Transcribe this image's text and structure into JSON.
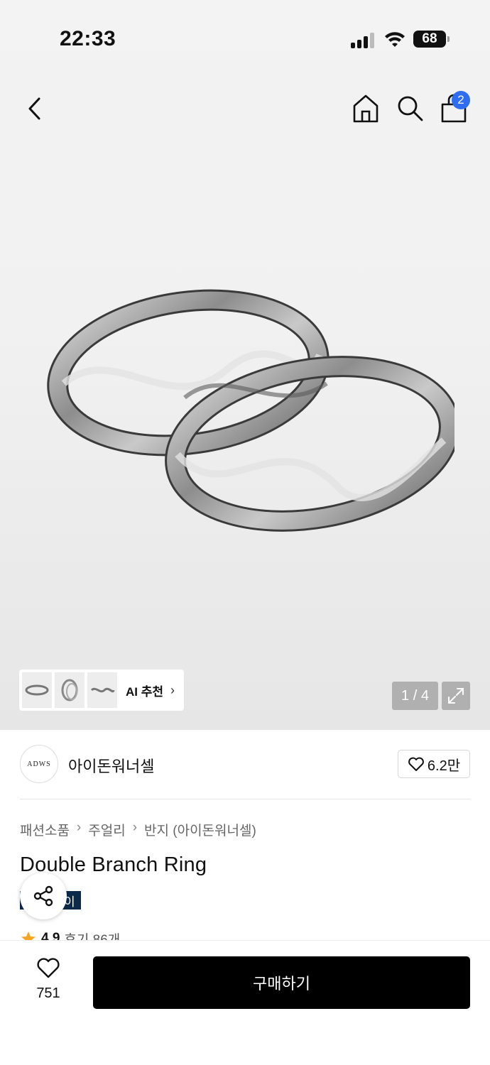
{
  "status": {
    "time": "22:33",
    "battery": "68"
  },
  "nav": {
    "cart_count": "2"
  },
  "gallery": {
    "ai_label": "AI 추천",
    "pager": "1 / 4"
  },
  "seller": {
    "logo_text": "ADWS",
    "name": "아이돈워너셀",
    "likes": "6.2만"
  },
  "breadcrumb": [
    "패션소품",
    "주얼리",
    "반지 (아이돈워너셀)"
  ],
  "product": {
    "title": "Double Branch Ring",
    "tag_tail": "이",
    "rating": "4.9",
    "reviews": "후기 86개"
  },
  "bottom": {
    "wish_count": "751",
    "buy_label": "구매하기"
  },
  "colors": {
    "badge": "#2e6cf0",
    "tag_bg": "#0b2a4a",
    "star": "#f5a623"
  }
}
